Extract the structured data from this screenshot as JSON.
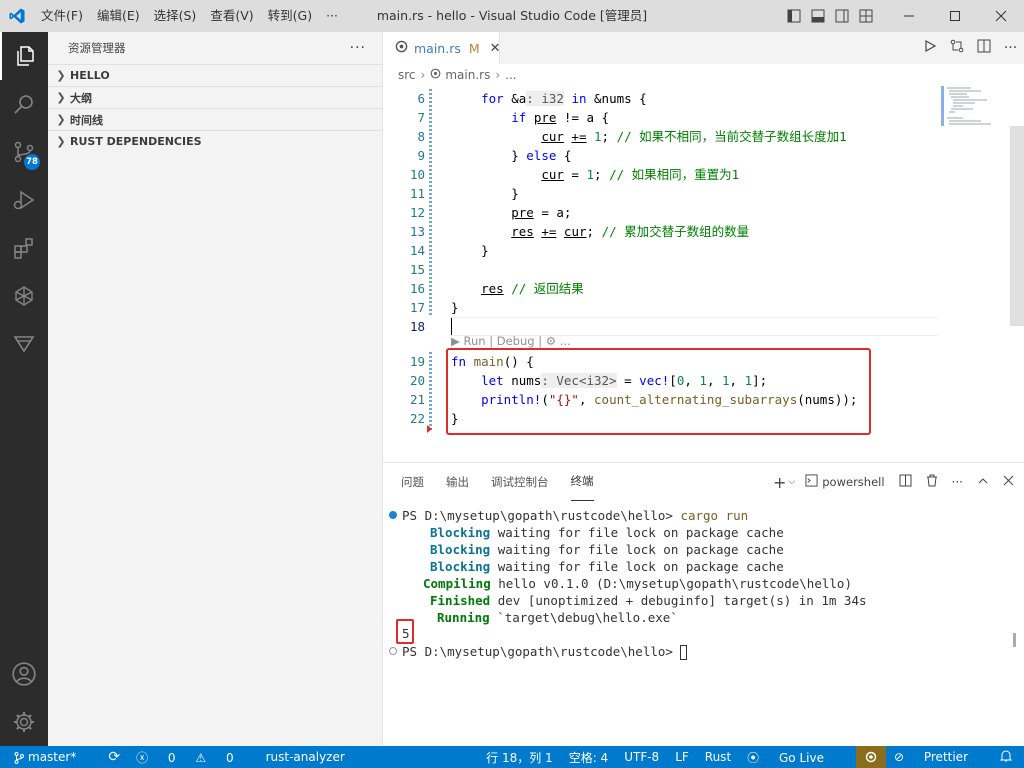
{
  "titlebar": {
    "menu": [
      "文件(F)",
      "编辑(E)",
      "选择(S)",
      "查看(V)",
      "转到(G)",
      "···"
    ],
    "title": "main.rs - hello - Visual Studio Code [管理员]"
  },
  "activity": {
    "badge": "78"
  },
  "sidebar": {
    "title": "资源管理器",
    "more": "···",
    "sections": [
      "HELLO",
      "大纲",
      "时间线",
      "RUST DEPENDENCIES"
    ]
  },
  "tab": {
    "filename": "main.rs",
    "modified": "M",
    "close": "✕"
  },
  "breadcrumb": [
    "src",
    "main.rs",
    "..."
  ],
  "editor": {
    "line_numbers": [
      "6",
      "7",
      "8",
      "9",
      "10",
      "11",
      "12",
      "13",
      "14",
      "15",
      "16",
      "17",
      "18",
      "19",
      "20",
      "21",
      "22"
    ],
    "codelens": "▶ Run | Debug | ⚙ ..."
  },
  "panel": {
    "tabs": [
      "问题",
      "输出",
      "调试控制台",
      "终端"
    ],
    "shell": "powershell",
    "terminal": {
      "prompt1": "PS D:\\mysetup\\gopath\\rustcode\\hello> ",
      "cmd": "cargo run",
      "lines": [
        {
          "tag": "Blocking",
          "text": " waiting for file lock on package cache"
        },
        {
          "tag": "Blocking",
          "text": " waiting for file lock on package cache"
        },
        {
          "tag": "Blocking",
          "text": " waiting for file lock on package cache"
        },
        {
          "tag": "Compiling",
          "text": " hello v0.1.0 (D:\\mysetup\\gopath\\rustcode\\hello)"
        },
        {
          "tag": "Finished",
          "text": " dev [unoptimized + debuginfo] target(s) in 1m 34s"
        },
        {
          "tag": "Running",
          "text": " `target\\debug\\hello.exe`"
        }
      ],
      "output": "5",
      "prompt2": "PS D:\\mysetup\\gopath\\rustcode\\hello> "
    }
  },
  "status": {
    "branch": "master*",
    "sync": "⟳",
    "errors": "0",
    "warnings": "0",
    "analyzer": "rust-analyzer",
    "position": "行 18，列 1",
    "spaces": "空格: 4",
    "encoding": "UTF-8",
    "eol": "LF",
    "language": "Rust",
    "golive": "Go Live",
    "prettier": "Prettier"
  },
  "colors": {
    "accent": "#007acc",
    "highlight_box": "#e12a2a"
  }
}
